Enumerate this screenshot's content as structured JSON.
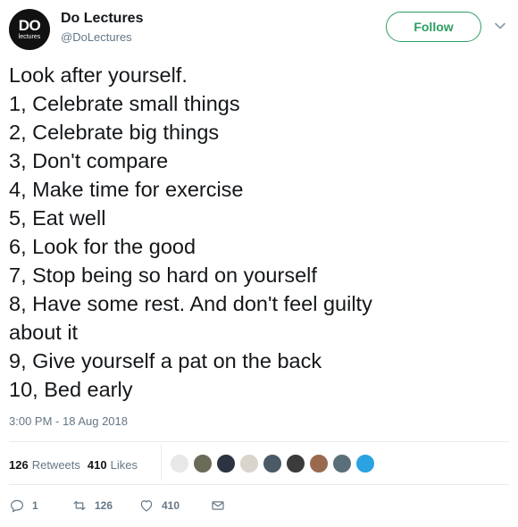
{
  "account": {
    "avatar_big": "DO",
    "avatar_small": "lectures",
    "display_name": "Do Lectures",
    "handle": "@DoLectures"
  },
  "follow_label": "Follow",
  "tweet": {
    "lines": [
      "Look after yourself.",
      "1, Celebrate small things",
      "2, Celebrate big things",
      "3, Don't compare",
      "4, Make time for exercise",
      "5, Eat well",
      "6, Look for the good",
      "7, Stop being so hard on yourself",
      "8, Have some rest. And don't feel guilty",
      "about it",
      "9, Give yourself a pat on the back",
      "10, Bed early"
    ],
    "timestamp": "3:00 PM - 18 Aug 2018"
  },
  "stats": {
    "retweets_count": "126",
    "retweets_label": "Retweets",
    "likes_count": "410",
    "likes_label": "Likes"
  },
  "likers": [
    {
      "icon": "avatar-liker-1",
      "color": "#e8e8e8"
    },
    {
      "icon": "avatar-liker-2",
      "color": "#6b6b5a"
    },
    {
      "icon": "avatar-liker-3",
      "color": "#2b3440"
    },
    {
      "icon": "avatar-liker-4",
      "color": "#d9d4cc"
    },
    {
      "icon": "avatar-liker-5",
      "color": "#4a5a66"
    },
    {
      "icon": "avatar-liker-6",
      "color": "#3b3b3b"
    },
    {
      "icon": "avatar-liker-7",
      "color": "#9a6a4f"
    },
    {
      "icon": "avatar-liker-8",
      "color": "#5b6f7a"
    },
    {
      "icon": "avatar-liker-9",
      "color": "#2aa3e0"
    }
  ],
  "actions": {
    "reply_count": "1",
    "retweet_count": "126",
    "like_count": "410"
  },
  "colors": {
    "follow_accent": "#2c9e63",
    "secondary_text": "#657786"
  }
}
